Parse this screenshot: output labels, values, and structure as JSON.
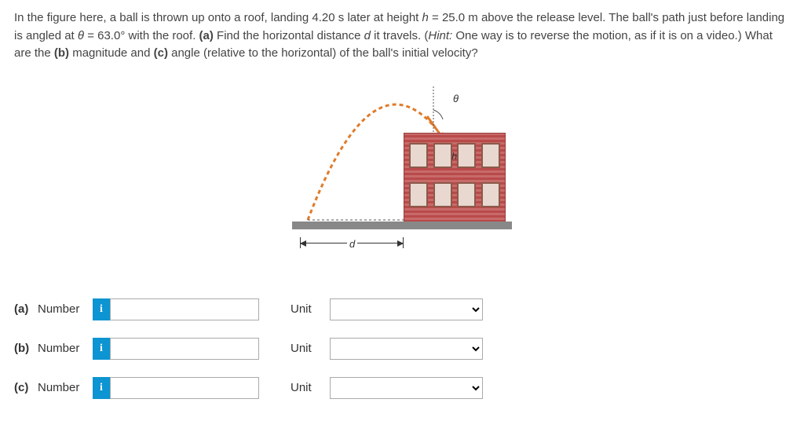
{
  "problem": {
    "text_part1": "In the figure here, a ball is thrown up onto a roof, landing 4.20 s later at height ",
    "h_var": "h",
    "text_part2": " = 25.0 m above the release level. The ball's path just before landing is angled at ",
    "theta_var": "θ",
    "text_part3": " = 63.0° with the roof. ",
    "part_a_bold": "(a)",
    "text_part4": " Find the horizontal distance ",
    "d_var": "d",
    "text_part5": " it travels. (",
    "hint_label": "Hint:",
    "text_part6": " One way is to reverse the motion, as if it is on a video.) What are the ",
    "part_b_bold": "(b)",
    "text_part7": " magnitude and ",
    "part_c_bold": "(c)",
    "text_part8": " angle (relative to the horizontal) of the ball's initial velocity?"
  },
  "figure": {
    "d_label": "d",
    "h_label": "h",
    "theta_label": "θ"
  },
  "answers": {
    "number_label": "Number",
    "unit_label": "Unit",
    "info_badge": "i",
    "rows": [
      {
        "part": "(a)"
      },
      {
        "part": "(b)"
      },
      {
        "part": "(c)"
      }
    ]
  }
}
